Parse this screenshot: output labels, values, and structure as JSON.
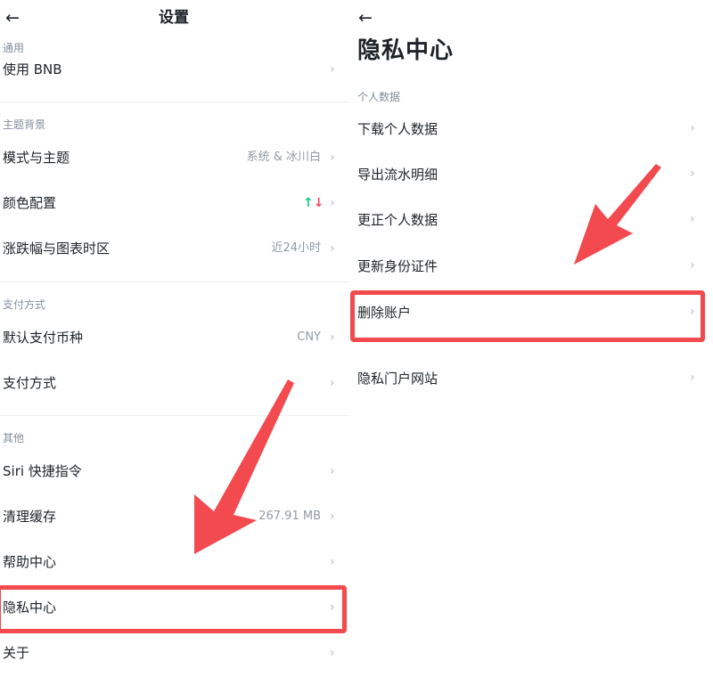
{
  "left": {
    "back_icon": "←",
    "title": "设置",
    "sections": {
      "general": "通用",
      "theme": "主题背景",
      "payment": "支付方式",
      "other": "其他"
    },
    "items": {
      "use_bnb": "使用 BNB",
      "mode_theme": "模式与主题",
      "mode_theme_value": "系统 & 冰川白",
      "color_config": "颜色配置",
      "change_chart_tz": "涨跌幅与图表时区",
      "change_chart_tz_value": "近24小时",
      "default_currency": "默认支付币种",
      "default_currency_value": "CNY",
      "payment_methods": "支付方式",
      "siri": "Siri 快捷指令",
      "clear_cache": "清理缓存",
      "clear_cache_value": "267.91 MB",
      "help_center": "帮助中心",
      "privacy_center": "隐私中心",
      "about": "关于"
    },
    "updown_up": "↑",
    "updown_down": "↓"
  },
  "right": {
    "back_icon": "←",
    "title": "隐私中心",
    "section": "个人数据",
    "items": {
      "download": "下载个人数据",
      "export": "导出流水明细",
      "correct": "更正个人数据",
      "update_id": "更新身份证件",
      "delete_account": "删除账户",
      "portal": "隐私门户网站"
    }
  },
  "chevron": "›",
  "colors": {
    "highlight": "#f24a4e",
    "text_primary": "#1e2329",
    "text_secondary": "#848e9c",
    "up": "#0ecb81",
    "down": "#f6465d"
  }
}
